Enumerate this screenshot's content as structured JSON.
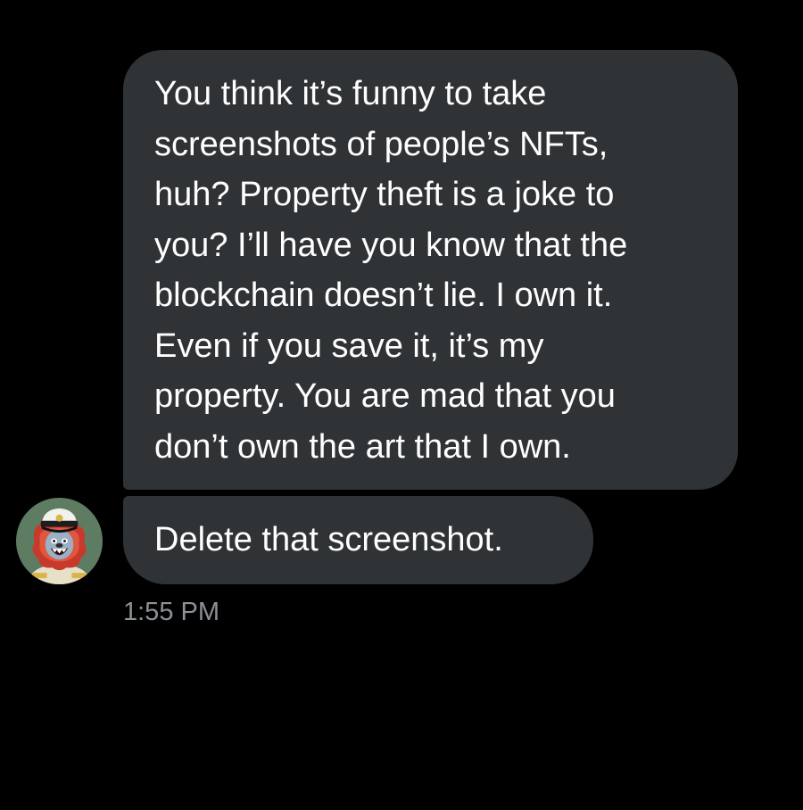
{
  "conversation": {
    "messages": [
      {
        "lines": [
          "You think it’s funny to take",
          "screenshots of people’s NFTs,",
          "huh? Property theft is a joke to",
          "you? I’ll have you know that the",
          "blockchain doesn’t lie. I own it.",
          "Even if you save it, it’s my",
          "property. You are mad that you",
          "don’t own the art that I own."
        ]
      },
      {
        "lines": [
          "Delete that screenshot."
        ]
      }
    ],
    "timestamp": "1:55 PM",
    "sender_avatar_icon": "lion-captain-avatar-icon",
    "colors": {
      "background": "#000000",
      "bubble": "#2f3336",
      "text": "#ffffff",
      "timestamp": "#8b9196"
    }
  }
}
